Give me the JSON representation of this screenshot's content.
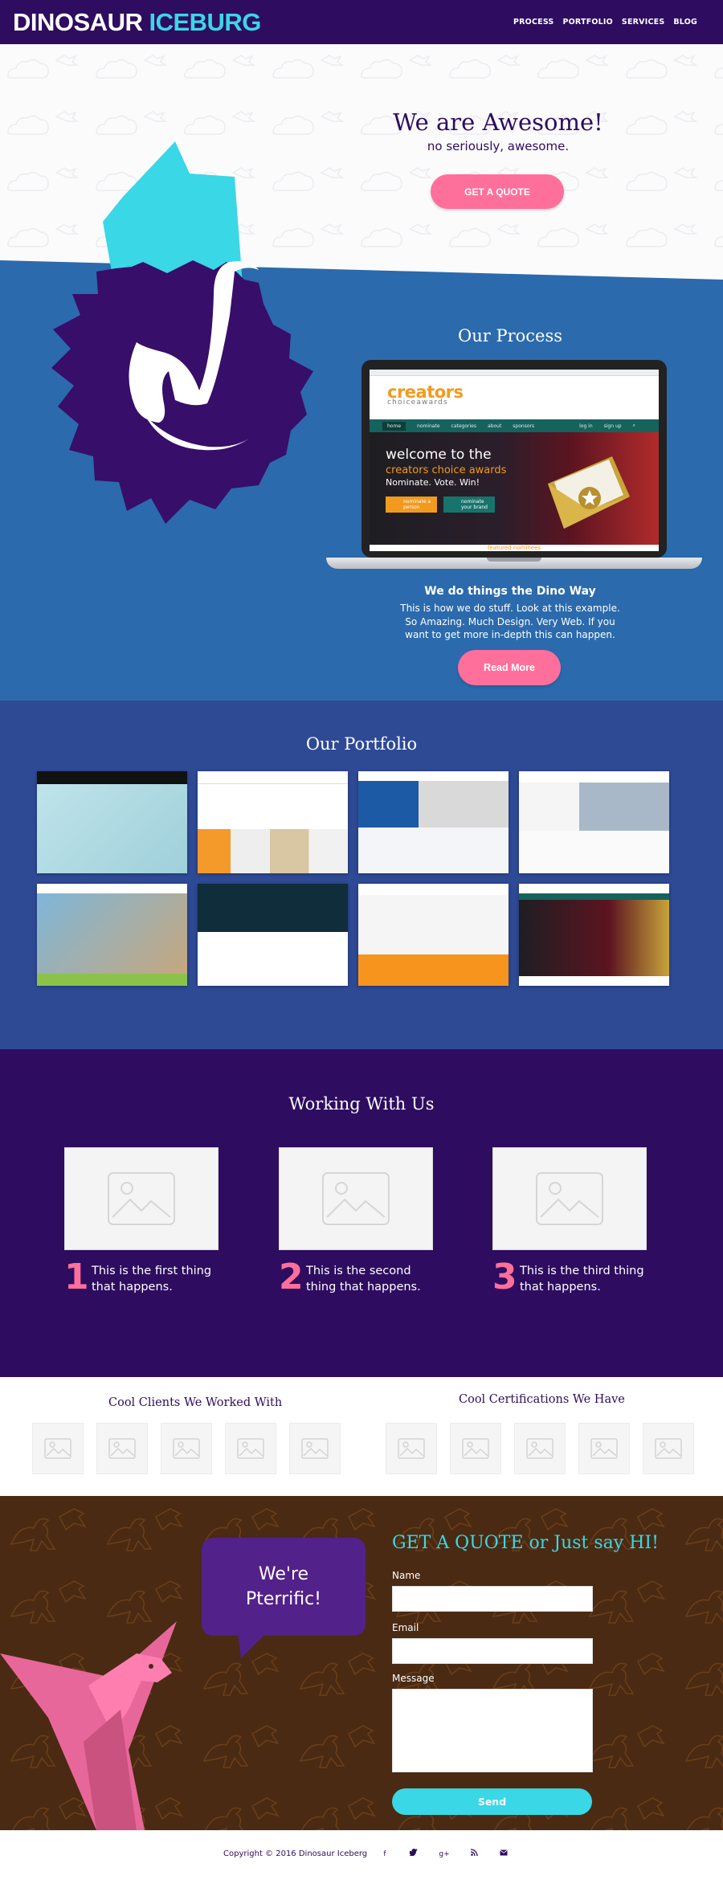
{
  "brand": {
    "part1": "DINOSAUR",
    "part2": "ICEBURG"
  },
  "nav": {
    "items": [
      "PROCESS",
      "PORTFOLIO",
      "SERVICES",
      "BLOG"
    ]
  },
  "hero": {
    "title": "We are Awesome!",
    "subtitle": "no seriously, awesome.",
    "cta": "GET A QUOTE"
  },
  "process": {
    "title": "Our Process",
    "laptop_site": {
      "logo": "creators",
      "logo_sub": "choiceawards",
      "nav": [
        "home",
        "nominate",
        "categories",
        "about",
        "sponsors",
        "log in",
        "sign up"
      ],
      "headline1": "welcome to the",
      "headline2": "creators choice awards",
      "headline3": "Nominate. Vote. Win!",
      "btn1": "nominate a person",
      "btn2": "nominate your brand",
      "featured": "featured nominees"
    },
    "heading": "We do things the Dino Way",
    "body": "This is how we do stuff. Look at this example. So Amazing. Much Design. Very Web. If you want to get more in-depth this can happen.",
    "cta": "Read More"
  },
  "portfolio": {
    "title": "Our Portfolio"
  },
  "working": {
    "title": "Working With Us",
    "steps": [
      {
        "num": "1",
        "text": "This is the first thing that happens."
      },
      {
        "num": "2",
        "text": "This is the second thing that happens."
      },
      {
        "num": "3",
        "text": "This is the third thing that happens."
      }
    ]
  },
  "clients": {
    "title": "Cool Clients We Worked With",
    "certs_title": "Cool Certifications We Have"
  },
  "contact": {
    "bubble_line1": "We're",
    "bubble_line2": "Pterrific!",
    "title": "GET A QUOTE or Just say HI!",
    "name_label": "Name",
    "email_label": "Email",
    "message_label": "Message",
    "send": "Send"
  },
  "footer": {
    "copyright": "Copyright © 2016  Dinosaur Iceberg",
    "social": [
      "f",
      "t",
      "g+",
      "rss",
      "mail"
    ]
  },
  "colors": {
    "purple": "#2e0c60",
    "cyan": "#3ad7e6",
    "pink": "#ff6f9c",
    "blue": "#2b6aad",
    "navy": "#2e4a95",
    "brown": "#4a2a12"
  }
}
